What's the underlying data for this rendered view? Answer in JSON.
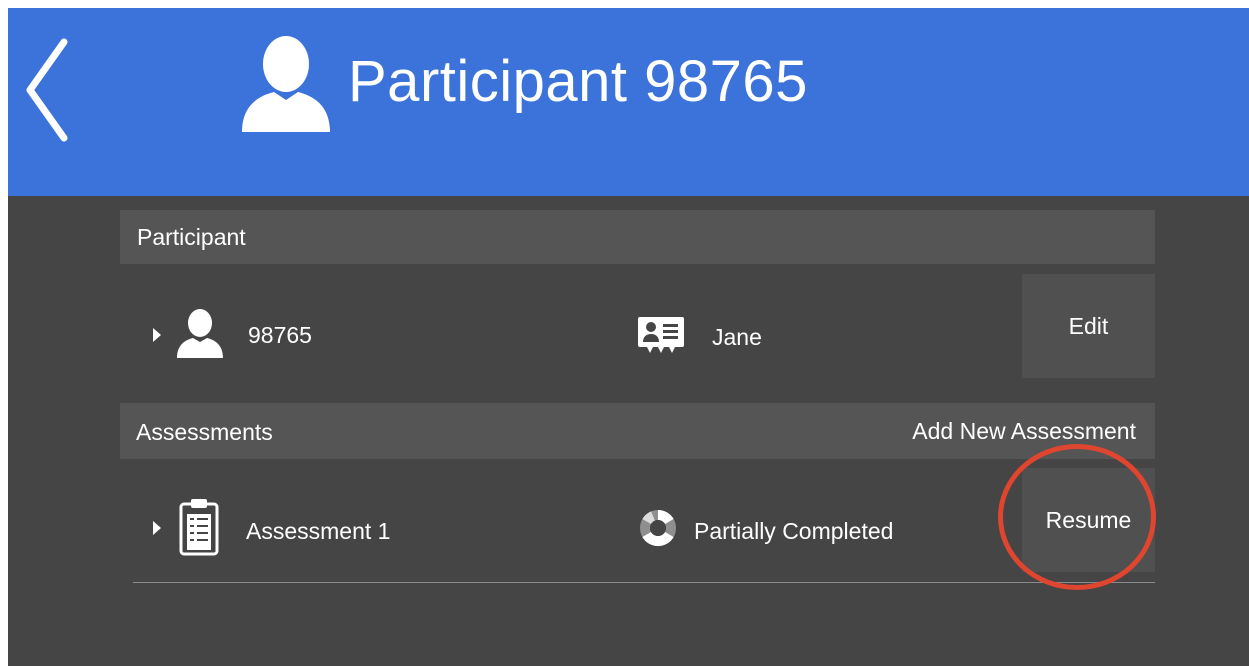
{
  "header": {
    "title": "Participant  98765",
    "back_icon": "chevron-left-icon",
    "avatar_icon": "person-icon",
    "background_color": "#3c73da"
  },
  "participant_section": {
    "label": "Participant",
    "row": {
      "id": "98765",
      "name": "Jane",
      "edit_label": "Edit",
      "icons": [
        "disclosure-triangle-icon",
        "person-icon",
        "id-card-icon"
      ]
    }
  },
  "assessments_section": {
    "label": "Assessments",
    "add_label": "Add New Assessment",
    "items": [
      {
        "name": "Assessment 1",
        "status": "Partially Completed",
        "action_label": "Resume",
        "icons": [
          "disclosure-triangle-icon",
          "clipboard-checklist-icon",
          "progress-ring-icon"
        ]
      }
    ]
  },
  "annotation": {
    "highlight_color": "#e0452f",
    "highlight_target": "Resume"
  }
}
